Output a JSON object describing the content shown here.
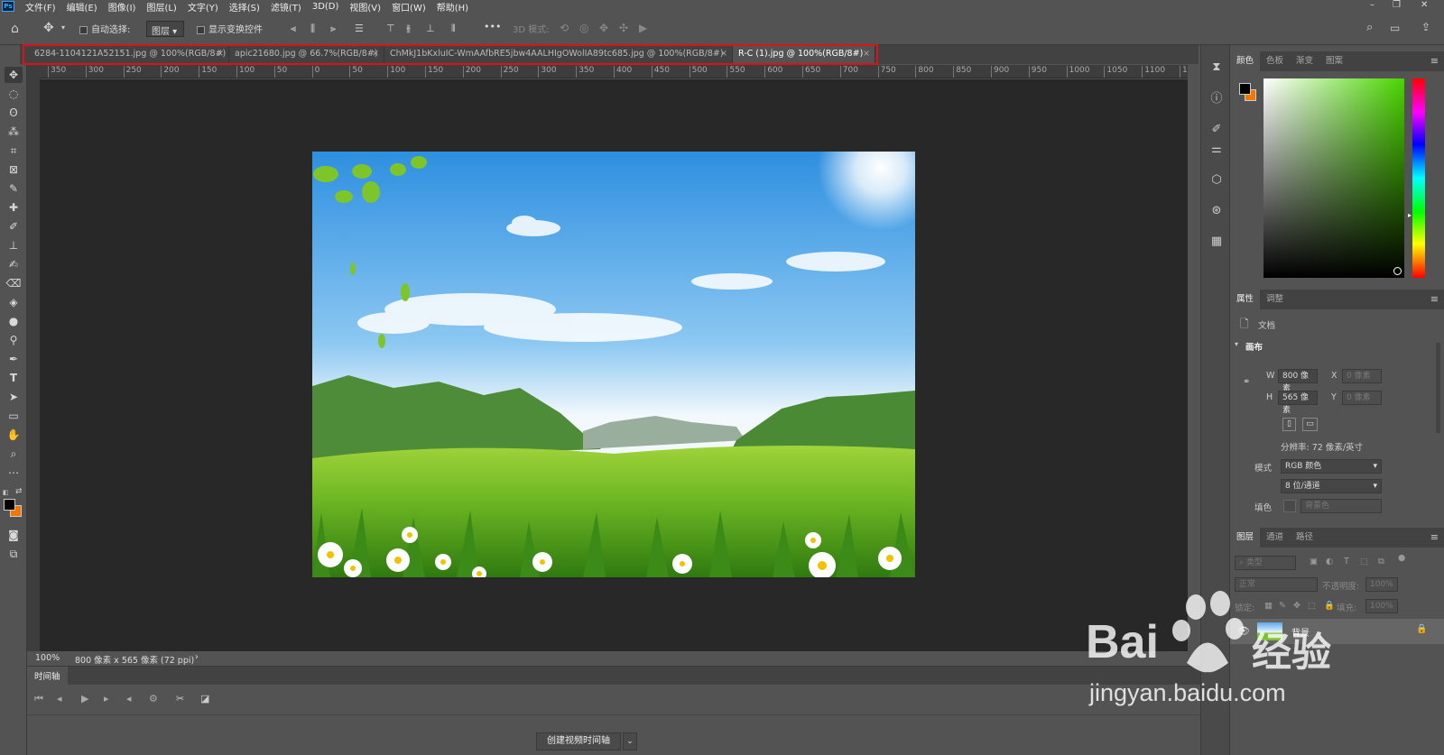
{
  "app": {
    "logo": "Ps"
  },
  "menu": [
    "文件(F)",
    "编辑(E)",
    "图像(I)",
    "图层(L)",
    "文字(Y)",
    "选择(S)",
    "滤镜(T)",
    "3D(D)",
    "视图(V)",
    "窗口(W)",
    "帮助(H)"
  ],
  "window_controls": {
    "minimize": "–",
    "restore": "❐",
    "close": "✕"
  },
  "options_bar": {
    "auto_select_label": "自动选择:",
    "auto_select_value": "图层",
    "show_transform_label": "显示变换控件",
    "more": "•••",
    "mode_3d_label": "3D 模式:"
  },
  "tabs": [
    {
      "label": "6284-1104121A52151.jpg @ 100%(RGB/8#)",
      "close": "×",
      "active": false
    },
    {
      "label": "apic21680.jpg @ 66.7%(RGB/8#)",
      "close": "×",
      "active": false
    },
    {
      "label": "ChMkJ1bKxluIC-WmAAfbRE5jbw4AALHIgOWolIA89tc685.jpg @ 100%(RGB/8#)",
      "close": "×",
      "active": false
    },
    {
      "label": "R-C (1).jpg @ 100%(RGB/8#)",
      "close": "×",
      "active": true
    }
  ],
  "ruler_labels": [
    "350",
    "300",
    "250",
    "200",
    "150",
    "100",
    "50",
    "0",
    "50",
    "100",
    "150",
    "200",
    "250",
    "300",
    "350",
    "400",
    "450",
    "500",
    "550",
    "600",
    "650",
    "700",
    "750",
    "800",
    "850",
    "900",
    "950",
    "1000",
    "1050",
    "1100",
    "1"
  ],
  "status": {
    "zoom": "100%",
    "doc_info": "800 像素 x 565 像素 (72 ppi)",
    "arrow": "›"
  },
  "timeline": {
    "tab": "时间轴",
    "create_button": "创建视频时间轴",
    "dropdown": "⌄"
  },
  "panels": {
    "color_tabs": [
      "颜色",
      "色板",
      "渐变",
      "图案"
    ],
    "props_tabs": [
      "属性",
      "调整"
    ],
    "props": {
      "doc_label": "文档",
      "canvas_section": "画布",
      "w_label": "W",
      "w_value": "800 像素",
      "h_label": "H",
      "h_value": "565 像素",
      "x_label": "X",
      "x_value": "0 像素",
      "y_label": "Y",
      "y_value": "0 像素",
      "resolution": "分辨率: 72 像素/英寸",
      "mode_label": "模式",
      "mode_value": "RGB 颜色",
      "depth_value": "8 位/通道",
      "fill_label": "填色",
      "fill_value": "背景色"
    },
    "layers_tabs": [
      "图层",
      "通道",
      "路径"
    ],
    "layers": {
      "search_placeholder": "类型",
      "blend_mode": "正常",
      "opacity_label": "不透明度:",
      "opacity_value": "100%",
      "lock_label": "锁定:",
      "fill_label": "填充:",
      "fill_value": "100%",
      "layer_name": "背景"
    }
  },
  "colors": {
    "foreground": "#000000",
    "background": "#f07800",
    "accent_red": "#e0101a"
  },
  "watermark": {
    "brand_left": "Bai",
    "brand_right": "经验",
    "url": "jingyan.baidu.com"
  }
}
